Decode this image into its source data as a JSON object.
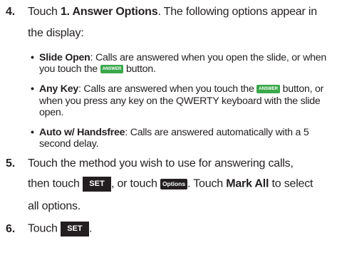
{
  "step4": {
    "number": "4.",
    "text_before": "Touch ",
    "bold": "1. Answer Options",
    "text_after": ". The following options appear in",
    "line2": "the display:"
  },
  "bullets": [
    {
      "marker": "•",
      "title": "Slide Open",
      "line1": ": Calls are answered when you open the slide, or when",
      "line2_before": "you touch the ",
      "icon": "ANSWER",
      "line2_after": " button."
    },
    {
      "marker": "•",
      "title": "Any Key",
      "line1_before": ": Calls are answered when you touch the ",
      "icon": "ANSWER",
      "line1_after": " button, or",
      "line2": "when you press any key on the QWERTY keyboard with the slide",
      "line3": "open."
    },
    {
      "marker": "•",
      "title": "Auto w/ Handsfree",
      "line1": ": Calls are answered automatically with a 5",
      "line2": "second delay."
    }
  ],
  "step5": {
    "number": "5.",
    "line1": "Touch the method you wish to use for answering calls,",
    "line2_a": "then touch ",
    "set_icon": "SET",
    "line2_b": ", or touch ",
    "options_icon": "Options",
    "line2_c": ". Touch ",
    "bold": "Mark All",
    "line2_d": " to select",
    "line3": "all options."
  },
  "step6": {
    "number": "6.",
    "text": "Touch ",
    "set_icon": "SET",
    "after": "."
  },
  "colors": {
    "text": "#231f20",
    "answer_icon_bg": "#3aa84b",
    "set_icon_bg": "#231f20"
  }
}
